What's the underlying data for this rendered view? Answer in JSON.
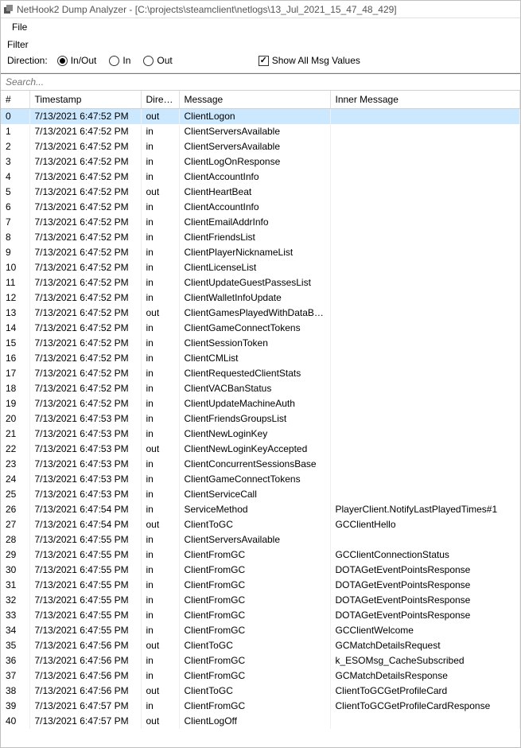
{
  "window": {
    "title": "NetHook2 Dump Analyzer - [C:\\projects\\steamclient\\netlogs\\13_Jul_2021_15_47_48_429]"
  },
  "menu": {
    "file": "File"
  },
  "filter": {
    "title": "Filter",
    "direction_label": "Direction:",
    "radio_inout": "In/Out",
    "radio_in": "In",
    "radio_out": "Out",
    "selected": "inout",
    "show_all_label": "Show All Msg Values",
    "show_all_checked": true
  },
  "search": {
    "placeholder": "Search..."
  },
  "columns": {
    "num": "#",
    "timestamp": "Timestamp",
    "direction": "Direct...",
    "message": "Message",
    "inner": "Inner Message"
  },
  "rows": [
    {
      "n": 0,
      "ts": "7/13/2021 6:47:52 PM",
      "dir": "out",
      "msg": "ClientLogon",
      "inner": "",
      "sel": true
    },
    {
      "n": 1,
      "ts": "7/13/2021 6:47:52 PM",
      "dir": "in",
      "msg": "ClientServersAvailable",
      "inner": ""
    },
    {
      "n": 2,
      "ts": "7/13/2021 6:47:52 PM",
      "dir": "in",
      "msg": "ClientServersAvailable",
      "inner": ""
    },
    {
      "n": 3,
      "ts": "7/13/2021 6:47:52 PM",
      "dir": "in",
      "msg": "ClientLogOnResponse",
      "inner": ""
    },
    {
      "n": 4,
      "ts": "7/13/2021 6:47:52 PM",
      "dir": "in",
      "msg": "ClientAccountInfo",
      "inner": ""
    },
    {
      "n": 5,
      "ts": "7/13/2021 6:47:52 PM",
      "dir": "out",
      "msg": "ClientHeartBeat",
      "inner": ""
    },
    {
      "n": 6,
      "ts": "7/13/2021 6:47:52 PM",
      "dir": "in",
      "msg": "ClientAccountInfo",
      "inner": ""
    },
    {
      "n": 7,
      "ts": "7/13/2021 6:47:52 PM",
      "dir": "in",
      "msg": "ClientEmailAddrInfo",
      "inner": ""
    },
    {
      "n": 8,
      "ts": "7/13/2021 6:47:52 PM",
      "dir": "in",
      "msg": "ClientFriendsList",
      "inner": ""
    },
    {
      "n": 9,
      "ts": "7/13/2021 6:47:52 PM",
      "dir": "in",
      "msg": "ClientPlayerNicknameList",
      "inner": ""
    },
    {
      "n": 10,
      "ts": "7/13/2021 6:47:52 PM",
      "dir": "in",
      "msg": "ClientLicenseList",
      "inner": ""
    },
    {
      "n": 11,
      "ts": "7/13/2021 6:47:52 PM",
      "dir": "in",
      "msg": "ClientUpdateGuestPassesList",
      "inner": ""
    },
    {
      "n": 12,
      "ts": "7/13/2021 6:47:52 PM",
      "dir": "in",
      "msg": "ClientWalletInfoUpdate",
      "inner": ""
    },
    {
      "n": 13,
      "ts": "7/13/2021 6:47:52 PM",
      "dir": "out",
      "msg": "ClientGamesPlayedWithDataBlob",
      "inner": ""
    },
    {
      "n": 14,
      "ts": "7/13/2021 6:47:52 PM",
      "dir": "in",
      "msg": "ClientGameConnectTokens",
      "inner": ""
    },
    {
      "n": 15,
      "ts": "7/13/2021 6:47:52 PM",
      "dir": "in",
      "msg": "ClientSessionToken",
      "inner": ""
    },
    {
      "n": 16,
      "ts": "7/13/2021 6:47:52 PM",
      "dir": "in",
      "msg": "ClientCMList",
      "inner": ""
    },
    {
      "n": 17,
      "ts": "7/13/2021 6:47:52 PM",
      "dir": "in",
      "msg": "ClientRequestedClientStats",
      "inner": ""
    },
    {
      "n": 18,
      "ts": "7/13/2021 6:47:52 PM",
      "dir": "in",
      "msg": "ClientVACBanStatus",
      "inner": ""
    },
    {
      "n": 19,
      "ts": "7/13/2021 6:47:52 PM",
      "dir": "in",
      "msg": "ClientUpdateMachineAuth",
      "inner": ""
    },
    {
      "n": 20,
      "ts": "7/13/2021 6:47:53 PM",
      "dir": "in",
      "msg": "ClientFriendsGroupsList",
      "inner": ""
    },
    {
      "n": 21,
      "ts": "7/13/2021 6:47:53 PM",
      "dir": "in",
      "msg": "ClientNewLoginKey",
      "inner": ""
    },
    {
      "n": 22,
      "ts": "7/13/2021 6:47:53 PM",
      "dir": "out",
      "msg": "ClientNewLoginKeyAccepted",
      "inner": ""
    },
    {
      "n": 23,
      "ts": "7/13/2021 6:47:53 PM",
      "dir": "in",
      "msg": "ClientConcurrentSessionsBase",
      "inner": ""
    },
    {
      "n": 24,
      "ts": "7/13/2021 6:47:53 PM",
      "dir": "in",
      "msg": "ClientGameConnectTokens",
      "inner": ""
    },
    {
      "n": 25,
      "ts": "7/13/2021 6:47:53 PM",
      "dir": "in",
      "msg": "ClientServiceCall",
      "inner": ""
    },
    {
      "n": 26,
      "ts": "7/13/2021 6:47:54 PM",
      "dir": "in",
      "msg": "ServiceMethod",
      "inner": "PlayerClient.NotifyLastPlayedTimes#1"
    },
    {
      "n": 27,
      "ts": "7/13/2021 6:47:54 PM",
      "dir": "out",
      "msg": "ClientToGC",
      "inner": "GCClientHello"
    },
    {
      "n": 28,
      "ts": "7/13/2021 6:47:55 PM",
      "dir": "in",
      "msg": "ClientServersAvailable",
      "inner": ""
    },
    {
      "n": 29,
      "ts": "7/13/2021 6:47:55 PM",
      "dir": "in",
      "msg": "ClientFromGC",
      "inner": "GCClientConnectionStatus"
    },
    {
      "n": 30,
      "ts": "7/13/2021 6:47:55 PM",
      "dir": "in",
      "msg": "ClientFromGC",
      "inner": "DOTAGetEventPointsResponse"
    },
    {
      "n": 31,
      "ts": "7/13/2021 6:47:55 PM",
      "dir": "in",
      "msg": "ClientFromGC",
      "inner": "DOTAGetEventPointsResponse"
    },
    {
      "n": 32,
      "ts": "7/13/2021 6:47:55 PM",
      "dir": "in",
      "msg": "ClientFromGC",
      "inner": "DOTAGetEventPointsResponse"
    },
    {
      "n": 33,
      "ts": "7/13/2021 6:47:55 PM",
      "dir": "in",
      "msg": "ClientFromGC",
      "inner": "DOTAGetEventPointsResponse"
    },
    {
      "n": 34,
      "ts": "7/13/2021 6:47:55 PM",
      "dir": "in",
      "msg": "ClientFromGC",
      "inner": "GCClientWelcome"
    },
    {
      "n": 35,
      "ts": "7/13/2021 6:47:56 PM",
      "dir": "out",
      "msg": "ClientToGC",
      "inner": "GCMatchDetailsRequest"
    },
    {
      "n": 36,
      "ts": "7/13/2021 6:47:56 PM",
      "dir": "in",
      "msg": "ClientFromGC",
      "inner": "k_ESOMsg_CacheSubscribed"
    },
    {
      "n": 37,
      "ts": "7/13/2021 6:47:56 PM",
      "dir": "in",
      "msg": "ClientFromGC",
      "inner": "GCMatchDetailsResponse"
    },
    {
      "n": 38,
      "ts": "7/13/2021 6:47:56 PM",
      "dir": "out",
      "msg": "ClientToGC",
      "inner": "ClientToGCGetProfileCard"
    },
    {
      "n": 39,
      "ts": "7/13/2021 6:47:57 PM",
      "dir": "in",
      "msg": "ClientFromGC",
      "inner": "ClientToGCGetProfileCardResponse"
    },
    {
      "n": 40,
      "ts": "7/13/2021 6:47:57 PM",
      "dir": "out",
      "msg": "ClientLogOff",
      "inner": ""
    }
  ]
}
